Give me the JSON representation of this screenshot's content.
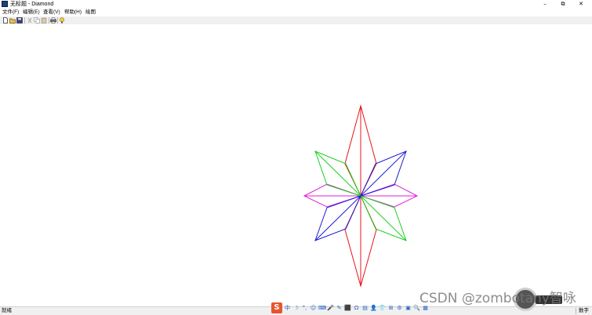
{
  "window": {
    "title": "无标题 - Diamond",
    "icon": "app-icon",
    "controls": {
      "minimize": "–",
      "maximize": "⧉",
      "close": "✕"
    }
  },
  "menubar": {
    "items": [
      {
        "label": "文件(F)"
      },
      {
        "label": "编辑(E)"
      },
      {
        "label": "查看(V)"
      },
      {
        "label": "帮助(H)"
      },
      {
        "label": "绘图"
      }
    ]
  },
  "toolbar": {
    "buttons": [
      "new-icon",
      "open-icon",
      "save-icon",
      "cut-icon",
      "copy-icon",
      "paste-icon",
      "print-icon",
      "about-icon"
    ]
  },
  "drawing": {
    "shape": "eight-point star (Diamond)",
    "colors": {
      "vertical": "#e8141c",
      "diag_green": "#19d11f",
      "diag_blue": "#1a1ad6",
      "horizontal": "#e020d8"
    }
  },
  "statusbar": {
    "left_text": "就绪",
    "right_text": "数字"
  },
  "ime": {
    "logo": "S",
    "items": [
      "中",
      "☽",
      "°,",
      "☺",
      "⌨",
      "🎤",
      "✎",
      "⬛",
      "Ω",
      "▤",
      "👤",
      "👕",
      "⊞",
      "⚙",
      "▣",
      "🔍",
      "▦"
    ]
  },
  "watermark": {
    "text": "CSDN @zombotany智咏"
  }
}
